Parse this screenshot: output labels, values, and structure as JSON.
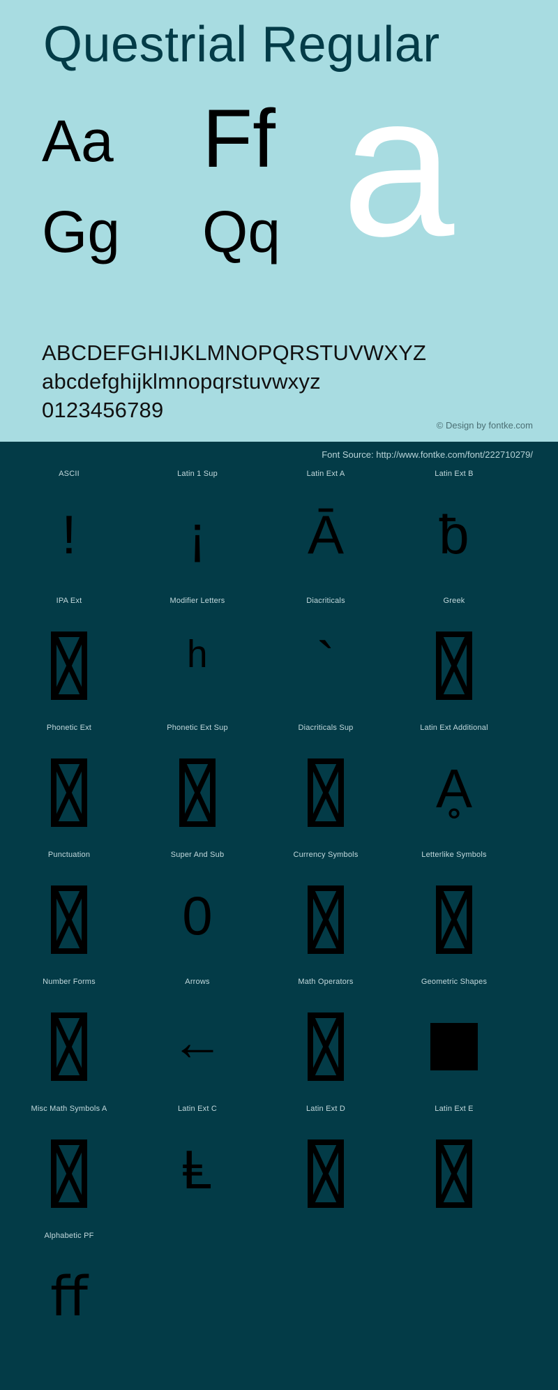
{
  "header": {
    "title": "Questrial Regular",
    "background_color": "#a8dce1",
    "title_color": "#033b47",
    "sample_pairs": [
      {
        "name": "pair-aa",
        "text": "Aa"
      },
      {
        "name": "pair-ff",
        "text": "Ff"
      },
      {
        "name": "pair-gg",
        "text": "Gg"
      },
      {
        "name": "pair-qq",
        "text": "Qq"
      }
    ],
    "showcase_letter": "a",
    "showcase_letter_color": "#ffffff",
    "alphabet_uppercase": "ABCDEFGHIJKLMNOPQRSTUVWXYZ",
    "alphabet_lowercase": "abcdefghijklmnopqrstuvwxyz",
    "digits": "0123456789",
    "credit": "© Design by fontke.com"
  },
  "dark_section": {
    "background_color": "#033b47",
    "source_label": "Font Source: http://www.fontke.com/font/222710279/",
    "label_color": "#c3d9dd",
    "glyph_color": "#000000"
  },
  "unicode_blocks": [
    {
      "label": "ASCII",
      "glyph": "!",
      "kind": "char"
    },
    {
      "label": "Latin 1 Sup",
      "glyph": "¡",
      "kind": "char"
    },
    {
      "label": "Latin Ext A",
      "glyph": "Ā",
      "kind": "char"
    },
    {
      "label": "Latin Ext B",
      "glyph": "ƀ",
      "kind": "char"
    },
    {
      "label": "IPA Ext",
      "glyph": "",
      "kind": "tofu"
    },
    {
      "label": "Modifier Letters",
      "glyph": "ʰ",
      "kind": "char"
    },
    {
      "label": "Diacriticals",
      "glyph": "`",
      "kind": "char"
    },
    {
      "label": "Greek",
      "glyph": "",
      "kind": "tofu"
    },
    {
      "label": "Phonetic Ext",
      "glyph": "",
      "kind": "tofu"
    },
    {
      "label": "Phonetic Ext Sup",
      "glyph": "",
      "kind": "tofu"
    },
    {
      "label": "Diacriticals Sup",
      "glyph": "",
      "kind": "tofu"
    },
    {
      "label": "Latin Ext Additional",
      "glyph": "Ḁ",
      "kind": "char"
    },
    {
      "label": "Punctuation",
      "glyph": "",
      "kind": "tofu"
    },
    {
      "label": "Super And Sub",
      "glyph": "0",
      "kind": "char"
    },
    {
      "label": "Currency Symbols",
      "glyph": "",
      "kind": "tofu"
    },
    {
      "label": "Letterlike Symbols",
      "glyph": "",
      "kind": "tofu"
    },
    {
      "label": "Number Forms",
      "glyph": "",
      "kind": "tofu"
    },
    {
      "label": "Arrows",
      "glyph": "←",
      "kind": "arrow"
    },
    {
      "label": "Math Operators",
      "glyph": "",
      "kind": "tofu"
    },
    {
      "label": "Geometric Shapes",
      "glyph": "■",
      "kind": "square"
    },
    {
      "label": "Misc Math Symbols A",
      "glyph": "",
      "kind": "tofu"
    },
    {
      "label": "Latin Ext C",
      "glyph": "Ⱡ",
      "kind": "char"
    },
    {
      "label": "Latin Ext D",
      "glyph": "",
      "kind": "tofu"
    },
    {
      "label": "Latin Ext E",
      "glyph": "",
      "kind": "tofu"
    },
    {
      "label": "Alphabetic PF",
      "glyph": "ﬀ",
      "kind": "char"
    }
  ]
}
